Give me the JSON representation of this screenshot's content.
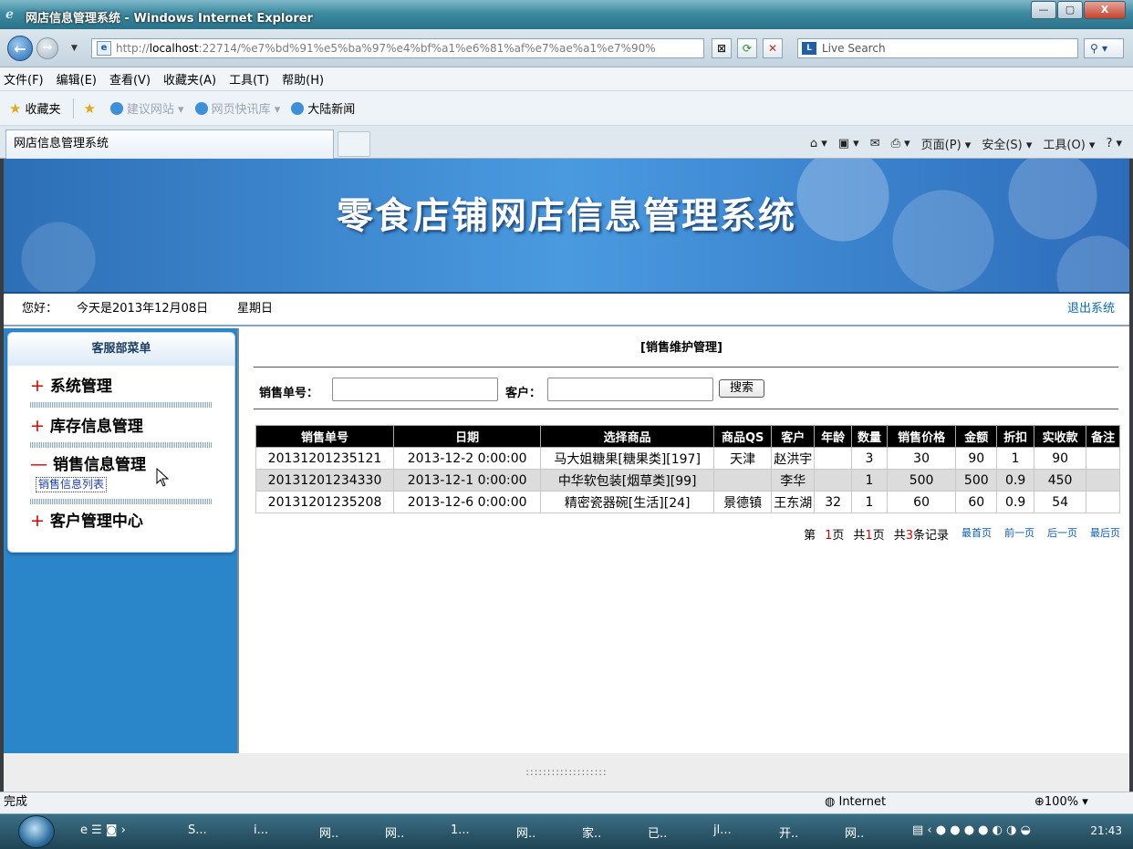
{
  "window": {
    "title": "网店信息管理系统 - Windows Internet Explorer",
    "min": "—",
    "max": "▢",
    "close": "X"
  },
  "address": {
    "prefix": "http://",
    "host": "localhost",
    "path": ":22714/%e7%bd%91%e5%ba%97%e4%bf%a1%e6%81%af%e7%ae%a1%e7%90%",
    "search_placeholder": "Live Search"
  },
  "menubar": [
    "文件(F)",
    "编辑(E)",
    "查看(V)",
    "收藏夹(A)",
    "工具(T)",
    "帮助(H)"
  ],
  "favbar": {
    "favorites": "收藏夹",
    "suggested": "建议网站 ▾",
    "webslice": "网页快讯库 ▾",
    "news": "大陆新闻"
  },
  "tab": {
    "label": "网店信息管理系统"
  },
  "cmdbar": [
    "页面(P) ▾",
    "安全(S) ▾",
    "工具(O) ▾"
  ],
  "banner": {
    "title": "零食店铺网店信息管理系统"
  },
  "info": {
    "greet": "您好：",
    "date": "今天是2013年12月08日",
    "weekday": "星期日",
    "logout": "退出系统"
  },
  "sidebar": {
    "header": "客服部菜单",
    "items": [
      {
        "mark": "+",
        "label": "系统管理"
      },
      {
        "mark": "+",
        "label": "库存信息管理"
      },
      {
        "mark": "—",
        "label": "销售信息管理"
      },
      {
        "mark": "+",
        "label": "客户管理中心"
      }
    ],
    "subitem": "销售信息列表"
  },
  "main": {
    "title": "[销售维护管理]",
    "order_label": "销售单号：",
    "customer_label": "客户：",
    "search_button": "搜索"
  },
  "table": {
    "headers": [
      "销售单号",
      "日期",
      "选择商品",
      "商品QS",
      "客户",
      "年龄",
      "数量",
      "销售价格",
      "金额",
      "折扣",
      "实收款",
      "备注"
    ],
    "rows": [
      [
        "20131201235121",
        "2013-12-2 0:00:00",
        "马大姐糖果[糖果类][197]",
        "天津",
        "赵洪宇",
        "",
        "3",
        "30",
        "90",
        "1",
        "90",
        ""
      ],
      [
        "20131201234330",
        "2013-12-1 0:00:00",
        "中华软包装[烟草类][99]",
        "",
        "李华",
        "",
        "1",
        "500",
        "500",
        "0.9",
        "450",
        ""
      ],
      [
        "20131201235208",
        "2013-12-6 0:00:00",
        "精密瓷器碗[生活][24]",
        "景德镇",
        "王东湖",
        "32",
        "1",
        "60",
        "60",
        "0.9",
        "54",
        ""
      ]
    ]
  },
  "pager": {
    "page_prefix": "第",
    "page_num": "1",
    "page_suffix": "页",
    "total_prefix": "共",
    "total_pages": "1",
    "total_suffix": "页",
    "rec_prefix": "共",
    "rec_count": "3",
    "rec_suffix": "条记录",
    "first": "最首页",
    "prev": "前一页",
    "next": "后一页",
    "last": "最后页"
  },
  "footer": {
    "text": ":::::::::::::::::::"
  },
  "status": {
    "done": "完成",
    "zone": "Internet",
    "zoom": "100%"
  },
  "taskbar": {
    "tasks": [
      "S...",
      "i...",
      "网..",
      "网..",
      "1...",
      "网..",
      "家..",
      "已..",
      "jl...",
      "开..",
      "网.."
    ],
    "clock": "21:43"
  }
}
